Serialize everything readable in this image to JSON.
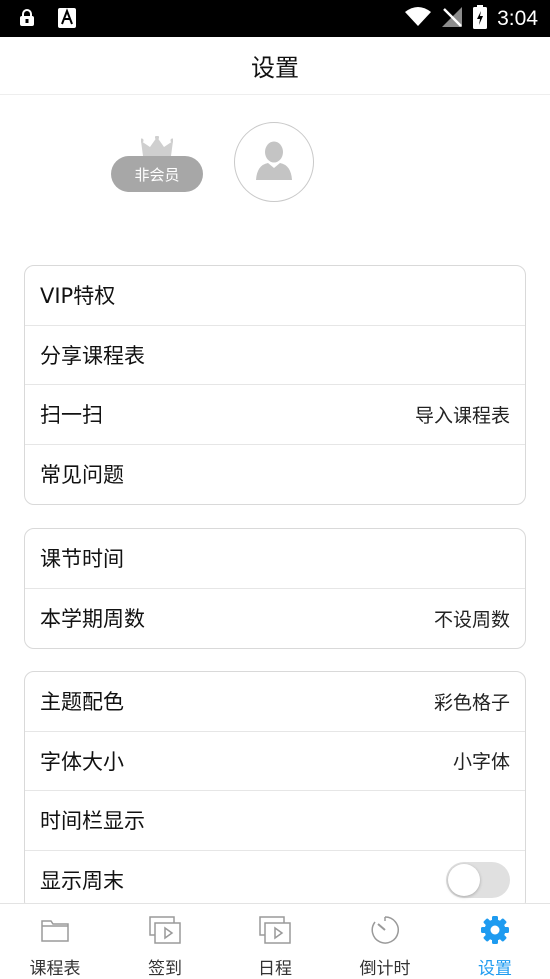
{
  "status_bar": {
    "time": "3:04",
    "left_icons": [
      "lock-icon",
      "font-a-icon"
    ],
    "right_icons": [
      "wifi-icon",
      "no-signal-icon",
      "battery-charging-icon"
    ]
  },
  "header": {
    "title": "设置"
  },
  "profile": {
    "badge": "非会员",
    "crown_icon": "crown-icon",
    "avatar_icon": "user-icon"
  },
  "group1": [
    {
      "label": "VIP特权",
      "value": ""
    },
    {
      "label": "分享课程表",
      "value": ""
    },
    {
      "label": "扫一扫",
      "value": "导入课程表"
    },
    {
      "label": "常见问题",
      "value": ""
    }
  ],
  "group2": [
    {
      "label": "课节时间",
      "value": ""
    },
    {
      "label": "本学期周数",
      "value": "不设周数"
    }
  ],
  "group3": [
    {
      "label": "主题配色",
      "value": "彩色格子"
    },
    {
      "label": "字体大小",
      "value": "小字体"
    },
    {
      "label": "时间栏显示",
      "value": ""
    },
    {
      "label": "显示周末",
      "value": "",
      "toggle_on": false
    }
  ],
  "tabs": [
    {
      "label": "课程表",
      "icon": "folder-icon"
    },
    {
      "label": "签到",
      "icon": "slides-play-icon"
    },
    {
      "label": "日程",
      "icon": "slides-play-icon"
    },
    {
      "label": "倒计时",
      "icon": "timer-icon"
    },
    {
      "label": "设置",
      "icon": "gear-icon",
      "active": true
    }
  ],
  "colors": {
    "accent": "#1e9bf0",
    "badge_bg": "#a7a7a7",
    "toggle_off": "#e0e0e0"
  }
}
